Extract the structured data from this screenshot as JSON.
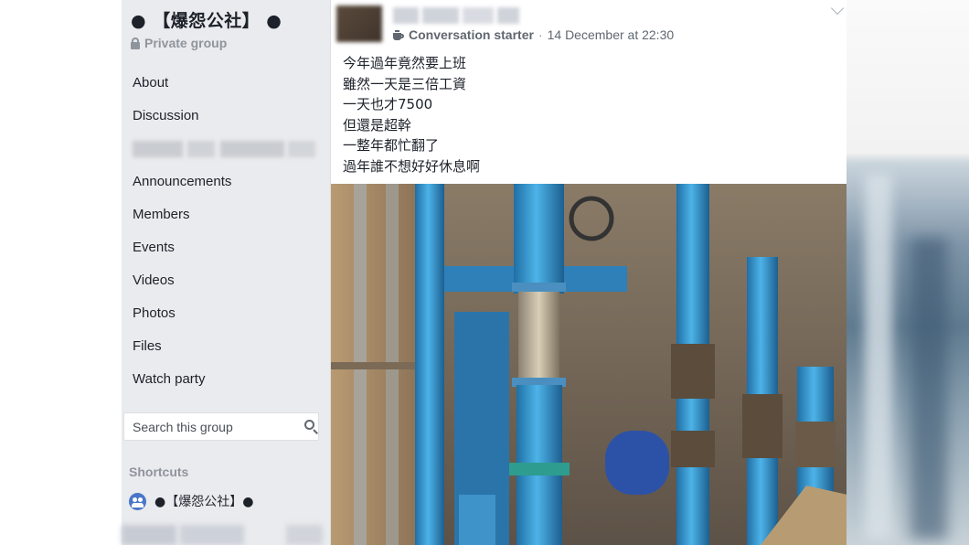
{
  "sidebar": {
    "group_title": "● 【爆怨公社】 ●",
    "privacy_label": "Private group",
    "nav_items": [
      {
        "label": "About"
      },
      {
        "label": "Discussion"
      },
      {
        "label": "Announcements"
      },
      {
        "label": "Members"
      },
      {
        "label": "Events"
      },
      {
        "label": "Videos"
      },
      {
        "label": "Photos"
      },
      {
        "label": "Files"
      },
      {
        "label": "Watch party"
      }
    ],
    "search_placeholder": "Search this group",
    "shortcuts_label": "Shortcuts",
    "shortcut_item": "●【爆怨公社】●"
  },
  "post": {
    "badge": "Conversation starter",
    "separator": "·",
    "timestamp": "14 December at 22:30",
    "lines": [
      "今年過年竟然要上班",
      "雖然一天是三倍工資",
      "一天也才7500",
      "但還是超幹",
      "一整年都忙翻了",
      "過年誰不想好好休息啊"
    ]
  },
  "colors": {
    "sidebar_bg": "#e9ebee",
    "text": "#1d2129",
    "muted": "#90949c",
    "group_icon": "#4a76c9",
    "pipe_blue": "#3fa0d8"
  },
  "icons": [
    "lock-icon",
    "search-icon",
    "group-icon",
    "coffee-badge-icon",
    "chevron-down-icon"
  ]
}
